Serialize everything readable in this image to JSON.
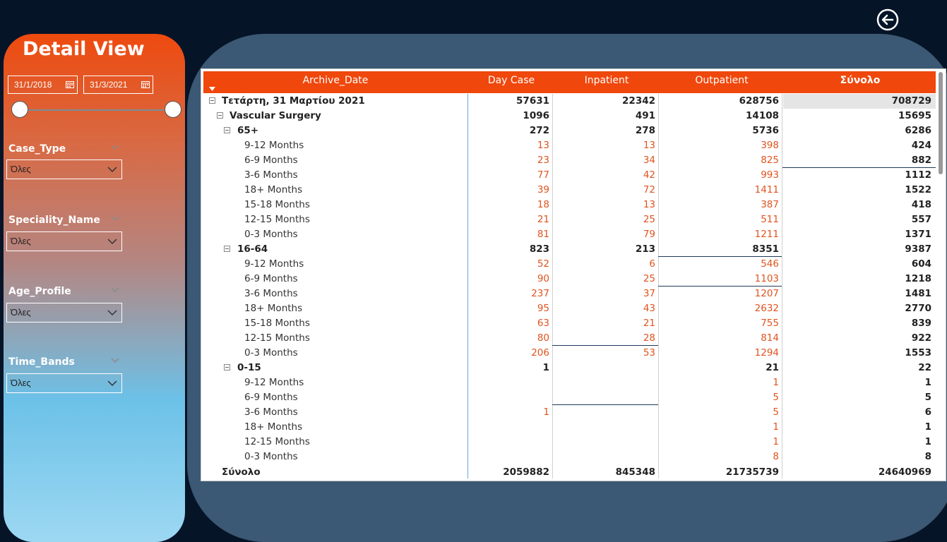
{
  "panel": {
    "title": "Detail View",
    "date_start": "31/1/2018",
    "date_end": "31/3/2021",
    "filters": [
      {
        "label": "Case_Type",
        "value": "Όλες"
      },
      {
        "label": "Speciality_Name",
        "value": "Όλες"
      },
      {
        "label": "Age_Profile",
        "value": "Όλες"
      },
      {
        "label": "Time_Bands",
        "value": "Όλες"
      }
    ]
  },
  "matrix": {
    "headers": [
      "Archive_Date",
      "Day Case",
      "Inpatient",
      "Outpatient",
      "Σύνολο"
    ],
    "rows": [
      {
        "level": 0,
        "label": "Τετάρτη, 31 Μαρτίου 2021",
        "values": [
          "57631",
          "22342",
          "628756",
          "708729"
        ]
      },
      {
        "level": 1,
        "label": "Vascular Surgery",
        "values": [
          "1096",
          "491",
          "14108",
          "15695"
        ]
      },
      {
        "level": 2,
        "label": "65+",
        "values": [
          "272",
          "278",
          "5736",
          "6286"
        ]
      },
      {
        "level": 3,
        "label": "9-12 Months",
        "values": [
          "13",
          "13",
          "398",
          "424"
        ]
      },
      {
        "level": 3,
        "label": "6-9 Months",
        "values": [
          "23",
          "34",
          "825",
          "882"
        ]
      },
      {
        "level": 3,
        "label": "3-6 Months",
        "values": [
          "77",
          "42",
          "993",
          "1112"
        ]
      },
      {
        "level": 3,
        "label": "18+ Months",
        "values": [
          "39",
          "72",
          "1411",
          "1522"
        ]
      },
      {
        "level": 3,
        "label": "15-18 Months",
        "values": [
          "18",
          "13",
          "387",
          "418"
        ]
      },
      {
        "level": 3,
        "label": "12-15 Months",
        "values": [
          "21",
          "25",
          "511",
          "557"
        ]
      },
      {
        "level": 3,
        "label": "0-3 Months",
        "values": [
          "81",
          "79",
          "1211",
          "1371"
        ]
      },
      {
        "level": 2,
        "label": "16-64",
        "values": [
          "823",
          "213",
          "8351",
          "9387"
        ]
      },
      {
        "level": 3,
        "label": "9-12 Months",
        "values": [
          "52",
          "6",
          "546",
          "604"
        ]
      },
      {
        "level": 3,
        "label": "6-9 Months",
        "values": [
          "90",
          "25",
          "1103",
          "1218"
        ]
      },
      {
        "level": 3,
        "label": "3-6 Months",
        "values": [
          "237",
          "37",
          "1207",
          "1481"
        ]
      },
      {
        "level": 3,
        "label": "18+ Months",
        "values": [
          "95",
          "43",
          "2632",
          "2770"
        ]
      },
      {
        "level": 3,
        "label": "15-18 Months",
        "values": [
          "63",
          "21",
          "755",
          "839"
        ]
      },
      {
        "level": 3,
        "label": "12-15 Months",
        "values": [
          "80",
          "28",
          "814",
          "922"
        ]
      },
      {
        "level": 3,
        "label": "0-3 Months",
        "values": [
          "206",
          "53",
          "1294",
          "1553"
        ]
      },
      {
        "level": 2,
        "label": "0-15",
        "values": [
          "1",
          "",
          "21",
          "22"
        ]
      },
      {
        "level": 3,
        "label": "9-12 Months",
        "values": [
          "",
          "",
          "1",
          "1"
        ]
      },
      {
        "level": 3,
        "label": "6-9 Months",
        "values": [
          "",
          "",
          "5",
          "5"
        ]
      },
      {
        "level": 3,
        "label": "3-6 Months",
        "values": [
          "1",
          "",
          "5",
          "6"
        ]
      },
      {
        "level": 3,
        "label": "18+ Months",
        "values": [
          "",
          "",
          "1",
          "1"
        ]
      },
      {
        "level": 3,
        "label": "12-15 Months",
        "values": [
          "",
          "",
          "1",
          "1"
        ]
      },
      {
        "level": 3,
        "label": "0-3 Months",
        "values": [
          "",
          "",
          "8",
          "8"
        ]
      }
    ],
    "total": {
      "label": "Σύνολο",
      "values": [
        "2059882",
        "845348",
        "21735739",
        "24640969"
      ]
    }
  },
  "colors": {
    "header_bg": "#f0470c",
    "detail_value": "#e0531f",
    "main_card": "#3b5874",
    "page_bg": "#061428"
  }
}
